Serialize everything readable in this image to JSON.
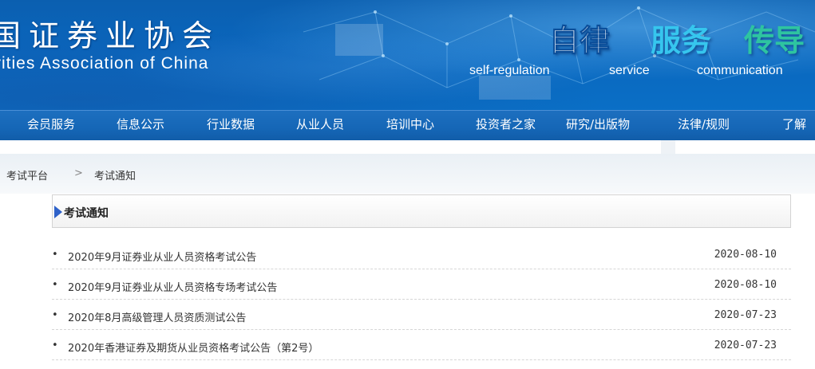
{
  "banner": {
    "logo_cn": "国证券业协会",
    "logo_en": "rities Association of China",
    "slogans": [
      {
        "cn": "自律",
        "en": "self-regulation"
      },
      {
        "cn": "服务",
        "en": "service"
      },
      {
        "cn": "传导",
        "en": "communication"
      }
    ],
    "colors": {
      "slogan_1": "#ffffff",
      "slogan_2": "#36c6ee",
      "slogan_3": "#2ec4a0",
      "background": "#0a66bd"
    }
  },
  "nav": {
    "items": [
      "会员服务",
      "信息公示",
      "行业数据",
      "从业人员",
      "培训中心",
      "投资者之家",
      "研究/出版物",
      "法律/规则",
      "了解"
    ]
  },
  "breadcrumb": {
    "root": "考试平台",
    "separator": ">",
    "current": "考试通知"
  },
  "panel": {
    "title": "考试通知"
  },
  "notices": [
    {
      "bullet": "•",
      "title": "2020年9月证券业从业人员资格考试公告",
      "date": "2020-08-10"
    },
    {
      "bullet": "•",
      "title": "2020年9月证券业从业人员资格专场考试公告",
      "date": "2020-08-10"
    },
    {
      "bullet": "•",
      "title": "2020年8月高级管理人员资质测试公告",
      "date": "2020-07-23"
    },
    {
      "bullet": "•",
      "title": "2020年香港证券及期货从业员资格考试公告（第2号）",
      "date": "2020-07-23"
    }
  ]
}
